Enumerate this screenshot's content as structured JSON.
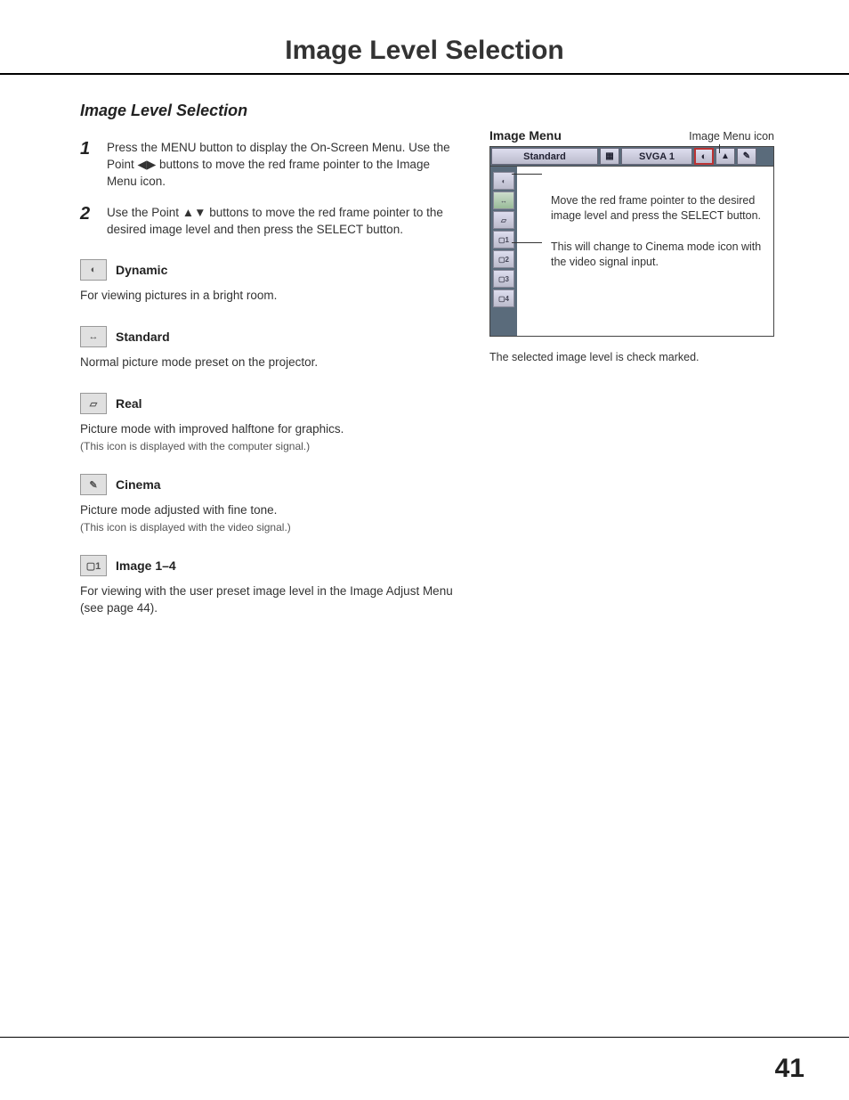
{
  "page_title": "Image Level Selection",
  "section_title": "Image Level Selection",
  "steps": [
    {
      "num": "1",
      "text": "Press the MENU button to display the On-Screen Menu. Use the Point ◀▶ buttons to move the red frame pointer to the Image Menu icon."
    },
    {
      "num": "2",
      "text": "Use the Point ▲▼ buttons to move the red frame pointer to the desired image level and then press the SELECT button."
    }
  ],
  "modes": [
    {
      "icon": "dyn",
      "title": "Dynamic",
      "desc": "For viewing pictures in a bright room.",
      "note": ""
    },
    {
      "icon": "std",
      "title": "Standard",
      "desc": "Normal picture mode preset on the projector.",
      "note": ""
    },
    {
      "icon": "real",
      "title": "Real",
      "desc": "Picture mode with improved halftone for graphics.",
      "note": "(This icon is displayed with the computer signal.)"
    },
    {
      "icon": "cin",
      "title": "Cinema",
      "desc": "Picture mode adjusted with fine tone.",
      "note": "(This icon is displayed with the video signal.)"
    },
    {
      "icon": "img1",
      "title": "Image 1–4",
      "desc": "For viewing with the user preset image level in the Image Adjust Menu (see page 44).",
      "note": ""
    }
  ],
  "right": {
    "heading": "Image Menu",
    "icon_label": "Image Menu icon",
    "top_bar": {
      "label": "Standard",
      "signal": "SVGA 1"
    },
    "side_icons": [
      "◐",
      "↔",
      "▱",
      "▢1",
      "▢2",
      "▢3",
      "▢4"
    ],
    "annot1": "Move the red frame pointer to the desired image level and press the SELECT button.",
    "annot2": "This will change to Cinema mode icon with the video signal input.",
    "footer": "The selected image level is check marked."
  },
  "page_number": "41"
}
